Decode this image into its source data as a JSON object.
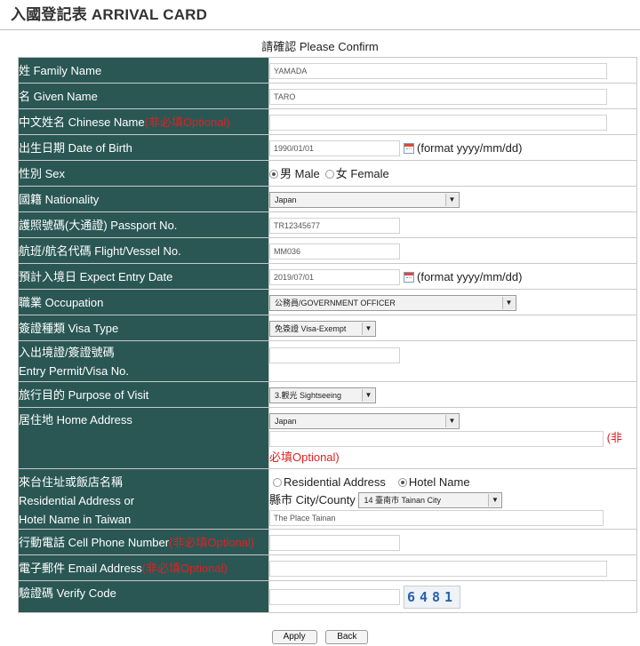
{
  "header": {
    "title": "入國登記表 ARRIVAL CARD",
    "subtitle": "請確認 Please Confirm"
  },
  "optional_text": "(非必填Optional)",
  "fields": {
    "family_name": {
      "label": "姓 Family Name",
      "value": "YAMADA"
    },
    "given_name": {
      "label": "名 Given Name",
      "value": "TARO"
    },
    "chinese_name": {
      "label": "中文姓名 Chinese Name",
      "value": ""
    },
    "dob": {
      "label": "出生日期 Date of Birth",
      "value": "1990/01/01",
      "format_hint": "(format yyyy/mm/dd)"
    },
    "sex": {
      "label": "性別 Sex",
      "options": [
        "男 Male",
        "女 Female"
      ],
      "selected": "男 Male"
    },
    "nationality": {
      "label": "國籍 Nationality",
      "selected": "Japan"
    },
    "passport": {
      "label": "護照號碼(大通證) Passport No.",
      "value": "TR12345677"
    },
    "flight": {
      "label": "航班/航名代碼 Flight/Vessel No.",
      "value": "MM036"
    },
    "entry_date": {
      "label": "預計入境日 Expect Entry Date",
      "value": "2019/07/01",
      "format_hint": "(format yyyy/mm/dd)"
    },
    "occupation": {
      "label": "職業 Occupation",
      "selected": "公務員/GOVERNMENT OFFICER"
    },
    "visa_type": {
      "label": "簽證種類 Visa Type",
      "selected": "免簽證 Visa-Exempt"
    },
    "entry_permit": {
      "label_line1": "入出境證/簽證號碼",
      "label_line2": "Entry Permit/Visa No.",
      "value": ""
    },
    "purpose": {
      "label": "旅行目的 Purpose of Visit",
      "selected": "3.觀光 Sightseeing"
    },
    "home_address": {
      "label": "居住地 Home Address",
      "country": "Japan",
      "value": "",
      "optional_part1": "(非",
      "optional_part2": "必填Optional)"
    },
    "taiwan_address": {
      "label_line1": "來台住址或飯店名稱",
      "label_line2": "Residential Address or",
      "label_line3": "Hotel Name in Taiwan",
      "options": [
        "Residential Address",
        "Hotel Name"
      ],
      "selected": "Hotel Name",
      "county_label": "縣市 City/County",
      "county_selected": "14 臺南市 Tainan City",
      "hotel_value": "The Place Tainan"
    },
    "cell_phone": {
      "label": "行動電話 Cell Phone Number",
      "value": ""
    },
    "email": {
      "label": "電子郵件 Email Address",
      "value": ""
    },
    "verify_code": {
      "label": "驗證碼 Verify Code",
      "value": "",
      "captcha_text": "6481"
    }
  },
  "buttons": {
    "apply": "Apply",
    "back": "Back"
  }
}
